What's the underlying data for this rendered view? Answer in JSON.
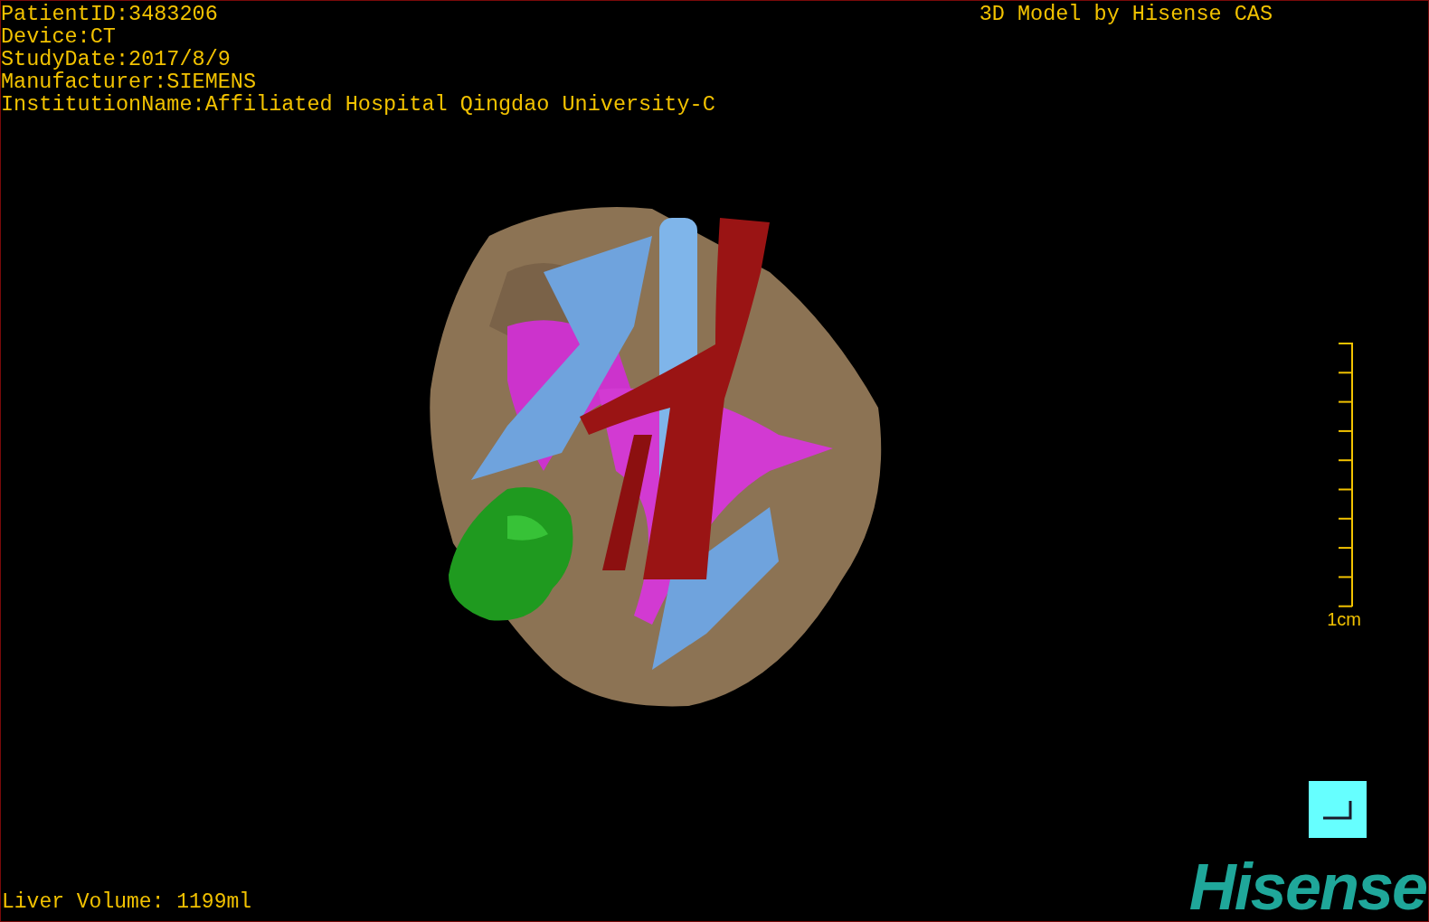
{
  "overlay": {
    "info_lines": [
      "PatientID:3483206",
      "Device:CT",
      "StudyDate:2017/8/9",
      "Manufacturer:SIEMENS",
      "InstitutionName:Affiliated Hospital Qingdao University-C"
    ],
    "title": "3D Model by Hisense CAS"
  },
  "scale_bar": {
    "label": "1cm"
  },
  "footer": {
    "liver_volume": "Liver Volume: 1199ml",
    "logo": "Hisense"
  }
}
